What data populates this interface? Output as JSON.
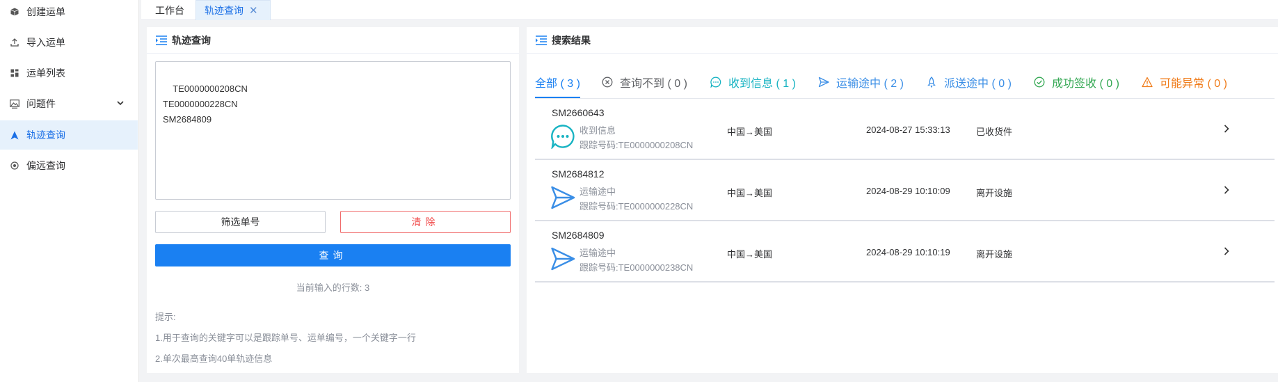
{
  "sidebar": {
    "items": [
      {
        "label": "创建运单",
        "icon": "box-icon"
      },
      {
        "label": "导入运单",
        "icon": "upload-icon"
      },
      {
        "label": "运单列表",
        "icon": "grid-icon"
      },
      {
        "label": "问题件",
        "icon": "image-icon",
        "expandable": true
      },
      {
        "label": "轨迹查询",
        "icon": "navigation-icon",
        "active": true
      },
      {
        "label": "偏远查询",
        "icon": "target-icon"
      }
    ]
  },
  "tabs": [
    {
      "label": "工作台"
    },
    {
      "label": "轨迹查询",
      "active": true
    }
  ],
  "query_panel": {
    "title": "轨迹查询",
    "input_value": "TE0000000208CN\nTE0000000228CN\nSM2684809",
    "filter_button": "筛选单号",
    "clear_button": "清除",
    "query_button": "查询",
    "line_count": "当前输入的行数: 3",
    "tips_title": "提示:",
    "tips": [
      "1.用于查询的关键字可以是跟踪单号、运单编号，一个关键字一行",
      "2.单次最高查询40单轨迹信息"
    ]
  },
  "results_panel": {
    "title": "搜索结果",
    "status_tabs": [
      {
        "label": "全部 ( 3 )",
        "color": "#1a80f2",
        "icon": ""
      },
      {
        "label": "查询不到 ( 0 )",
        "color": "#606266",
        "icon": "circle-x-icon"
      },
      {
        "label": "收到信息 ( 1 )",
        "color": "#17b3c2",
        "icon": "chat-bubble-icon"
      },
      {
        "label": "运输途中 ( 2 )",
        "color": "#3a8ee6",
        "icon": "send-icon"
      },
      {
        "label": "派送途中 ( 0 )",
        "color": "#3a8ee6",
        "icon": "rocket-icon"
      },
      {
        "label": "成功签收 ( 0 )",
        "color": "#34a853",
        "icon": "check-circle-icon"
      },
      {
        "label": "可能异常 ( 0 )",
        "color": "#f07c1a",
        "icon": "warning-icon"
      }
    ],
    "rows": [
      {
        "number": "SM2660643",
        "status": "收到信息",
        "tracking": "跟踪号码:TE0000000208CN",
        "route": "中国→美国",
        "time": "2024-08-27 15:33:13",
        "event": "已收货件",
        "icon": "chat-bubble-icon"
      },
      {
        "number": "SM2684812",
        "status": "运输途中",
        "tracking": "跟踪号码:TE0000000228CN",
        "route": "中国→美国",
        "time": "2024-08-29 10:10:09",
        "event": "离开设施",
        "icon": "send-icon"
      },
      {
        "number": "SM2684809",
        "status": "运输途中",
        "tracking": "跟踪号码:TE0000000238CN",
        "route": "中国→美国",
        "time": "2024-08-29 10:10:19",
        "event": "离开设施",
        "icon": "send-icon"
      }
    ]
  },
  "colors": {
    "primary": "#1a80f2",
    "danger": "#f04848",
    "received": "#17b3c2",
    "transit": "#3a8ee6"
  }
}
